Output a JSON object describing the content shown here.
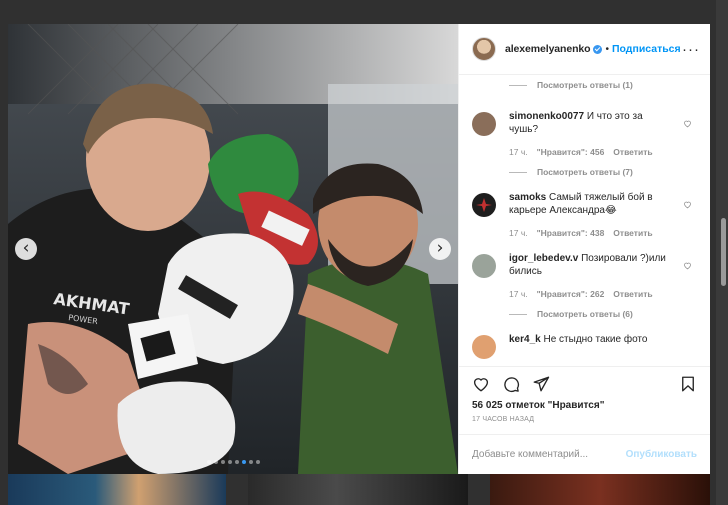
{
  "post": {
    "username": "alexemelyanenko",
    "separator": "•",
    "follow_label": "Подписаться",
    "more_label": "···"
  },
  "media": {
    "prev_label": "‹",
    "next_label": "›",
    "slide_count": 8,
    "active_slide": 5
  },
  "comments": {
    "top_replies": "Посмотреть ответы (1)",
    "items": [
      {
        "user": "simonenko0077",
        "text": "И что это за чушь?",
        "time": "17 ч.",
        "likes": "\"Нравится\": 456",
        "reply": "Ответить",
        "replies": "Посмотреть ответы (7)",
        "avatar_color": "#8a6e5a"
      },
      {
        "user": "samoks",
        "text": "Самый тяжелый бой в карьере Александра😂",
        "time": "17 ч.",
        "likes": "\"Нравится\": 438",
        "reply": "Ответить",
        "replies": "",
        "avatar_color": "#1e1e1e"
      },
      {
        "user": "igor_lebedev.v",
        "text": "Позировали ?)или бились",
        "time": "17 ч.",
        "likes": "\"Нравится\": 262",
        "reply": "Ответить",
        "replies": "Посмотреть ответы (6)",
        "avatar_color": "#9aa39a"
      },
      {
        "user": "ker4_k",
        "text": "Не стыдно такие фото",
        "time": "",
        "likes": "",
        "reply": "",
        "replies": "",
        "avatar_color": "#e0a070"
      }
    ]
  },
  "actions": {
    "like_icon": "heart-icon",
    "comment_icon": "comment-icon",
    "share_icon": "paper-plane-icon",
    "save_icon": "bookmark-icon"
  },
  "likes_text": "56 025 отметок \"Нравится\"",
  "time_text": "17 ЧАСОВ НАЗАД",
  "add_comment": {
    "placeholder": "Добавьте комментарий...",
    "publish_label": "Опубликовать"
  },
  "colors": {
    "accent": "#0095f6",
    "verified": "#3897f0",
    "muted": "#8e8e8e",
    "publish_disabled": "#b2dffc"
  }
}
